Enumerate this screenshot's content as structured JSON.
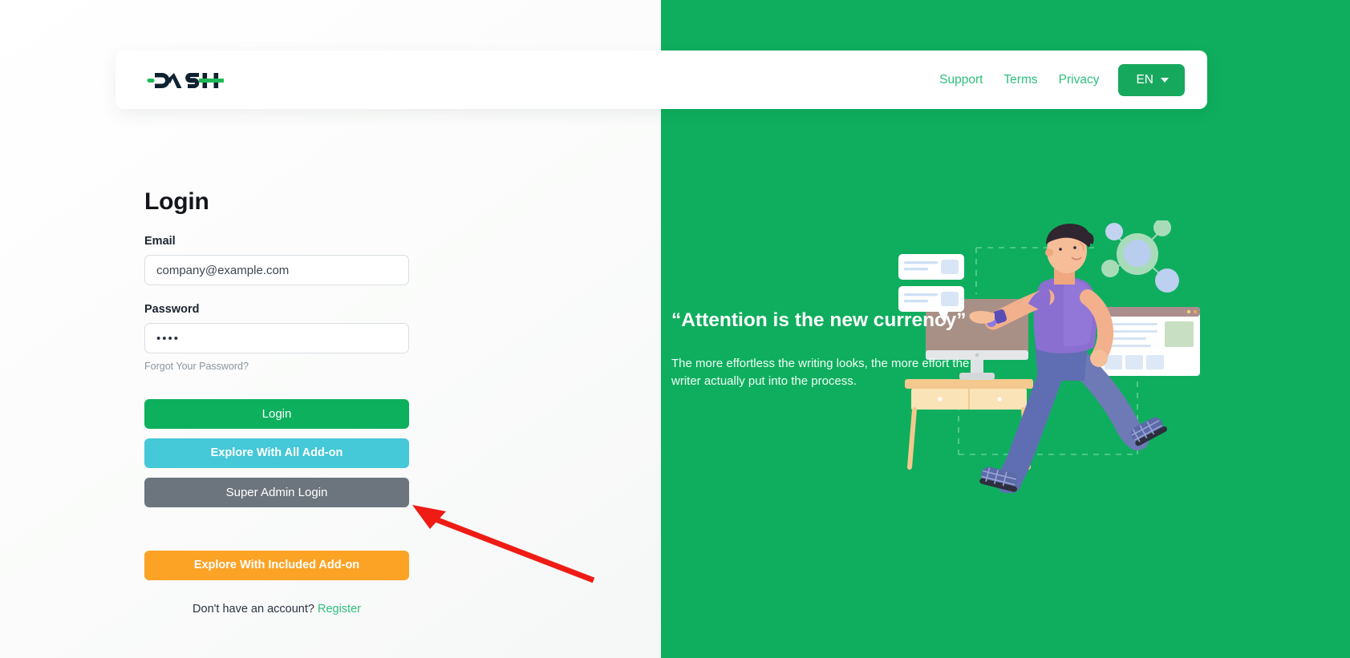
{
  "header": {
    "logo_text": "DASH",
    "logo_icon": "dash-wordmark-logo",
    "nav": [
      {
        "label": "Support",
        "name": "support"
      },
      {
        "label": "Terms",
        "name": "terms"
      },
      {
        "label": "Privacy",
        "name": "privacy"
      }
    ],
    "language": {
      "label": "EN",
      "caret_icon": "chevron-down-icon"
    }
  },
  "login": {
    "title": "Login",
    "email": {
      "label": "Email",
      "value": "",
      "placeholder": "company@example.com"
    },
    "password": {
      "label": "Password",
      "value": "••••",
      "masked_char_count": 4
    },
    "forgot_password": "Forgot Your Password?",
    "buttons": {
      "login": "Login",
      "explore_all": "Explore With All Add-on",
      "super_admin": "Super Admin Login",
      "explore_included": "Explore With Included Add-on"
    },
    "register_prompt": "Don't have an account?",
    "register_link": "Register"
  },
  "promo": {
    "quote": "“Attention is the new currency”",
    "description": "The more effortless the writing looks, the more effort the writer actually put into the process.",
    "illustration_name": "person-running-past-desk-illustration"
  },
  "annotation": {
    "arrow_color": "#ee1c15",
    "arrow_target": "super-admin-login-button"
  },
  "colors": {
    "brand_green": "#0fae5e",
    "button_green": "#0db05d",
    "button_cyan": "#45c8d8",
    "button_gray": "#6c757d",
    "button_orange": "#fca326",
    "link_green": "#2fbf7e",
    "logo_dark": "#0f2231"
  }
}
